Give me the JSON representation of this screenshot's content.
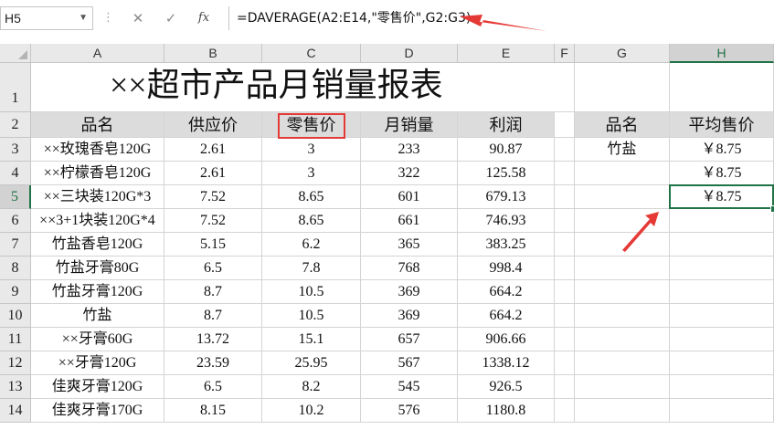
{
  "formula_bar": {
    "name_box": "H5",
    "cancel_icon": "✕",
    "enter_icon": "✓",
    "fx_label": "fx",
    "formula": "=DAVERAGE(A2:E14,\"零售价\",G2:G3)"
  },
  "columns": [
    "A",
    "B",
    "C",
    "D",
    "E",
    "F",
    "G",
    "H"
  ],
  "rows": [
    "1",
    "2",
    "3",
    "4",
    "5",
    "6",
    "7",
    "8",
    "9",
    "10",
    "11",
    "12",
    "13",
    "14"
  ],
  "sheet": {
    "title": "××超市产品月销量报表",
    "headers": [
      "品名",
      "供应价",
      "零售价",
      "月销量",
      "利润"
    ],
    "data": [
      [
        "××玫瑰香皂120G",
        "2.61",
        "3",
        "233",
        "90.87"
      ],
      [
        "××柠檬香皂120G",
        "2.61",
        "3",
        "322",
        "125.58"
      ],
      [
        "××三块装120G*3",
        "7.52",
        "8.65",
        "601",
        "679.13"
      ],
      [
        "××3+1块装120G*4",
        "7.52",
        "8.65",
        "661",
        "746.93"
      ],
      [
        "竹盐香皂120G",
        "5.15",
        "6.2",
        "365",
        "383.25"
      ],
      [
        "竹盐牙膏80G",
        "6.5",
        "7.8",
        "768",
        "998.4"
      ],
      [
        "竹盐牙膏120G",
        "8.7",
        "10.5",
        "369",
        "664.2"
      ],
      [
        "竹盐",
        "8.7",
        "10.5",
        "369",
        "664.2"
      ],
      [
        "××牙膏60G",
        "13.72",
        "15.1",
        "657",
        "906.66"
      ],
      [
        "××牙膏120G",
        "23.59",
        "25.95",
        "567",
        "1338.12"
      ],
      [
        "佳爽牙膏120G",
        "6.5",
        "8.2",
        "545",
        "926.5"
      ],
      [
        "佳爽牙膏170G",
        "8.15",
        "10.2",
        "576",
        "1180.8"
      ]
    ],
    "criteria_headers": [
      "品名",
      "平均售价"
    ],
    "criteria_value": "竹盐",
    "avg_values": [
      "￥8.75",
      "￥8.75",
      "￥8.75"
    ]
  },
  "colors": {
    "accent_green": "#217346",
    "annotation_red": "#e53935",
    "header_fill": "#dcdcdc"
  }
}
